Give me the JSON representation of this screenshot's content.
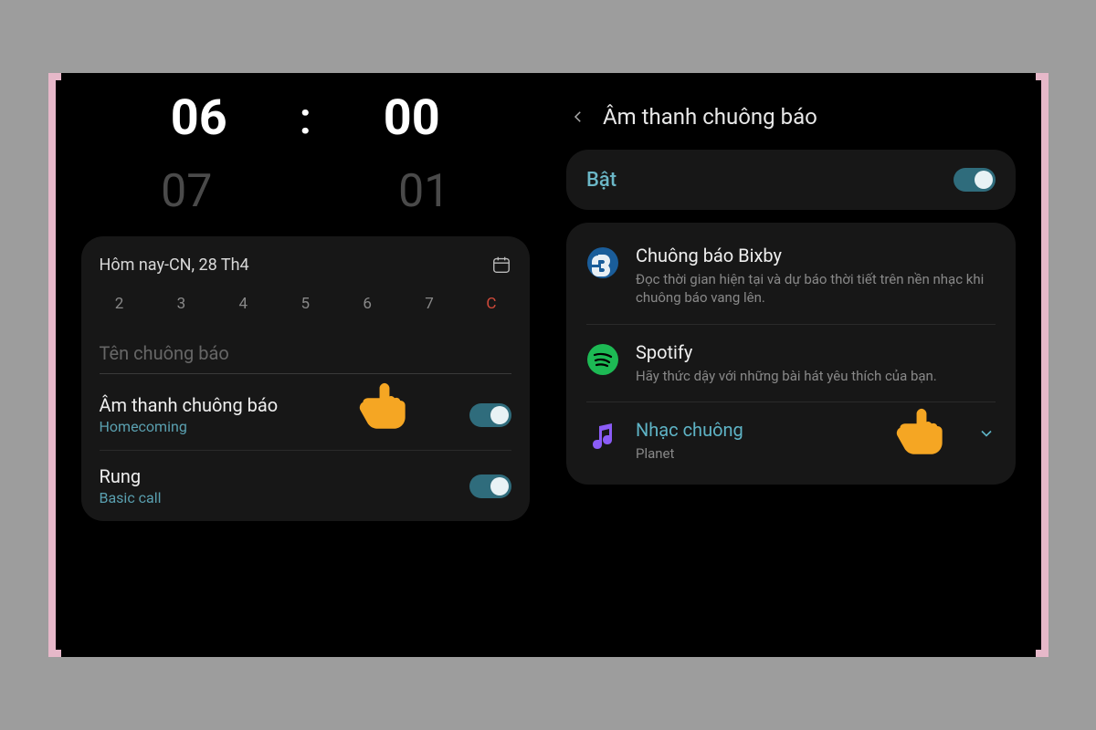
{
  "left": {
    "time_hour_selected": "06",
    "time_sep": ":",
    "time_minute_selected": "00",
    "time_hour_next": "07",
    "time_minute_next": "01",
    "date_label": "Hôm nay-CN, 28 Th4",
    "days": [
      "2",
      "3",
      "4",
      "5",
      "6",
      "7",
      "C"
    ],
    "alarm_name_placeholder": "Tên chuông báo",
    "sound": {
      "title": "Âm thanh chuông báo",
      "sub": "Homecoming"
    },
    "vibrate": {
      "title": "Rung",
      "sub": "Basic call"
    }
  },
  "right": {
    "header": "Âm thanh chuông báo",
    "enable_label": "Bật",
    "bixby": {
      "title": "Chuông báo Bixby",
      "sub": "Đọc thời gian hiện tại và dự báo thời tiết trên nền nhạc khi chuông báo vang lên."
    },
    "spotify": {
      "title": "Spotify",
      "sub": "Hãy thức dậy với những bài hát yêu thích của bạn."
    },
    "ringtone": {
      "title": "Nhạc chuông",
      "sub": "Planet"
    }
  }
}
